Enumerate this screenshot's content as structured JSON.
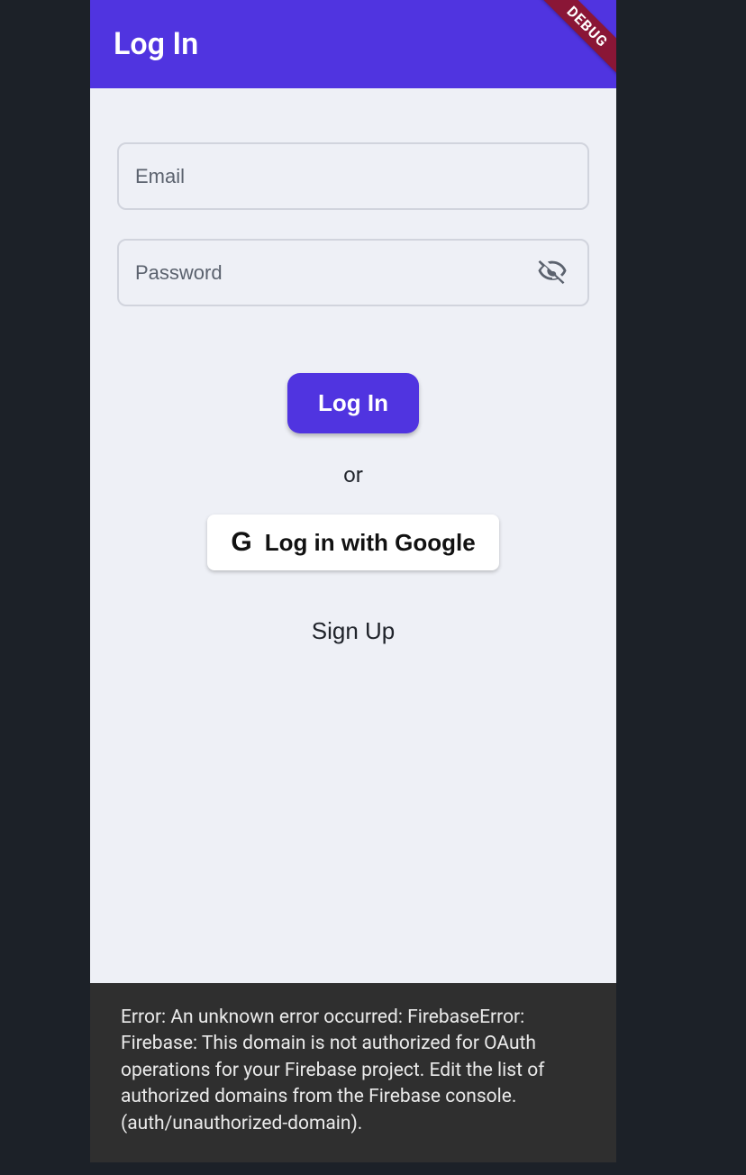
{
  "appbar": {
    "title": "Log In"
  },
  "debug": {
    "label": "DEBUG"
  },
  "fields": {
    "email_placeholder": "Email",
    "email_value": "",
    "password_placeholder": "Password",
    "password_value": ""
  },
  "buttons": {
    "login": "Log In",
    "google": "Log in with Google",
    "signup": "Sign Up"
  },
  "labels": {
    "or": "or"
  },
  "icons": {
    "google": "G",
    "visibility_off": "visibility-off-icon"
  },
  "colors": {
    "primary": "#5034e0",
    "debug_banner": "#8a1636",
    "background": "#eef0f6",
    "error_bg": "#2f2f2f"
  },
  "error": {
    "message": "Error: An unknown error occurred: FirebaseError: Firebase: This domain is not authorized for OAuth operations for your Firebase project. Edit the list of authorized domains from the Firebase console. (auth/unauthorized-domain)."
  }
}
